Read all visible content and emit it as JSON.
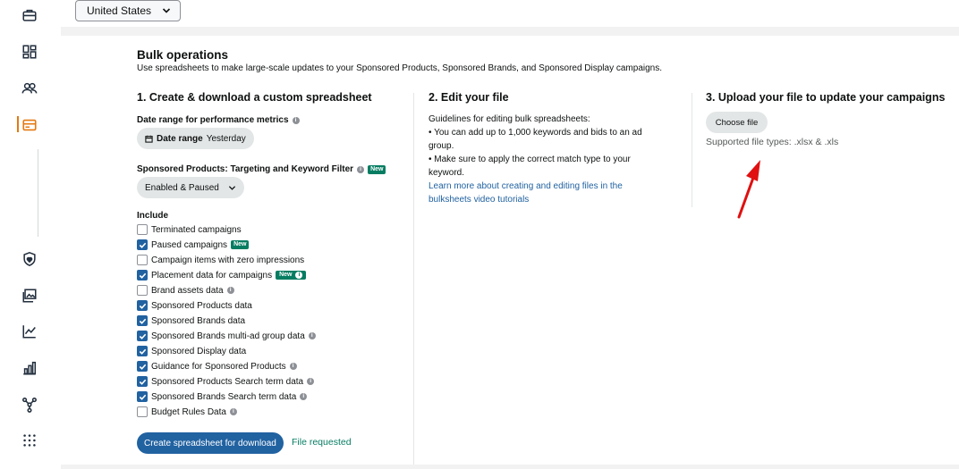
{
  "header": {
    "country": "United States"
  },
  "bulk": {
    "title": "Bulk operations",
    "subtitle": "Use spreadsheets to make large-scale updates to your Sponsored Products, Sponsored Brands, and Sponsored Display campaigns."
  },
  "col1": {
    "heading": "1. Create & download a custom spreadsheet",
    "date_label": "Date range for performance metrics",
    "date_pill_bold": "Date range",
    "date_pill_value": "Yesterday",
    "filter_label": "Sponsored Products: Targeting and Keyword Filter",
    "new_badge": "New",
    "filter_value": "Enabled & Paused",
    "include_label": "Include",
    "items": [
      {
        "label": "Terminated campaigns"
      },
      {
        "label": "Paused campaigns"
      },
      {
        "label": "Campaign items with zero impressions"
      },
      {
        "label": "Placement data for campaigns"
      },
      {
        "label": "Brand assets data"
      },
      {
        "label": "Sponsored Products data"
      },
      {
        "label": "Sponsored Brands data"
      },
      {
        "label": "Sponsored Brands multi-ad group data"
      },
      {
        "label": "Sponsored Display data"
      },
      {
        "label": "Guidance for Sponsored Products"
      },
      {
        "label": "Sponsored Products Search term data"
      },
      {
        "label": "Sponsored Brands Search term data"
      },
      {
        "label": "Budget Rules Data"
      }
    ],
    "create_button": "Create spreadsheet for download",
    "status": "File requested"
  },
  "col2": {
    "heading": "2. Edit your file",
    "guidelines_title": "Guidelines for editing bulk spreadsheets:",
    "bullet1": "• You can add up to 1,000 keywords and bids to an ad group.",
    "bullet2": "• Make sure to apply the correct match type to your keyword.",
    "link": "Learn more about creating and editing files in the bulksheets video tutorials"
  },
  "col3": {
    "heading": "3. Upload your file to update your campaigns",
    "choose_button": "Choose file",
    "supported": "Supported file types: .xlsx & .xls"
  },
  "colors": {
    "accent_blue": "#2162a1",
    "success_green": "#067d62",
    "annotation_red": "#e01010",
    "active_nav": "#e47911"
  },
  "icons": [
    "briefcase-icon",
    "dashboard-icon",
    "people-icon",
    "card-icon",
    "shield-heart-icon",
    "image-gallery-icon",
    "line-chart-icon",
    "bar-chart-icon",
    "network-icon",
    "grid-dots-icon",
    "calendar-icon",
    "chevron-down-icon",
    "info-icon",
    "checkmark-icon",
    "red-arrow-icon"
  ]
}
